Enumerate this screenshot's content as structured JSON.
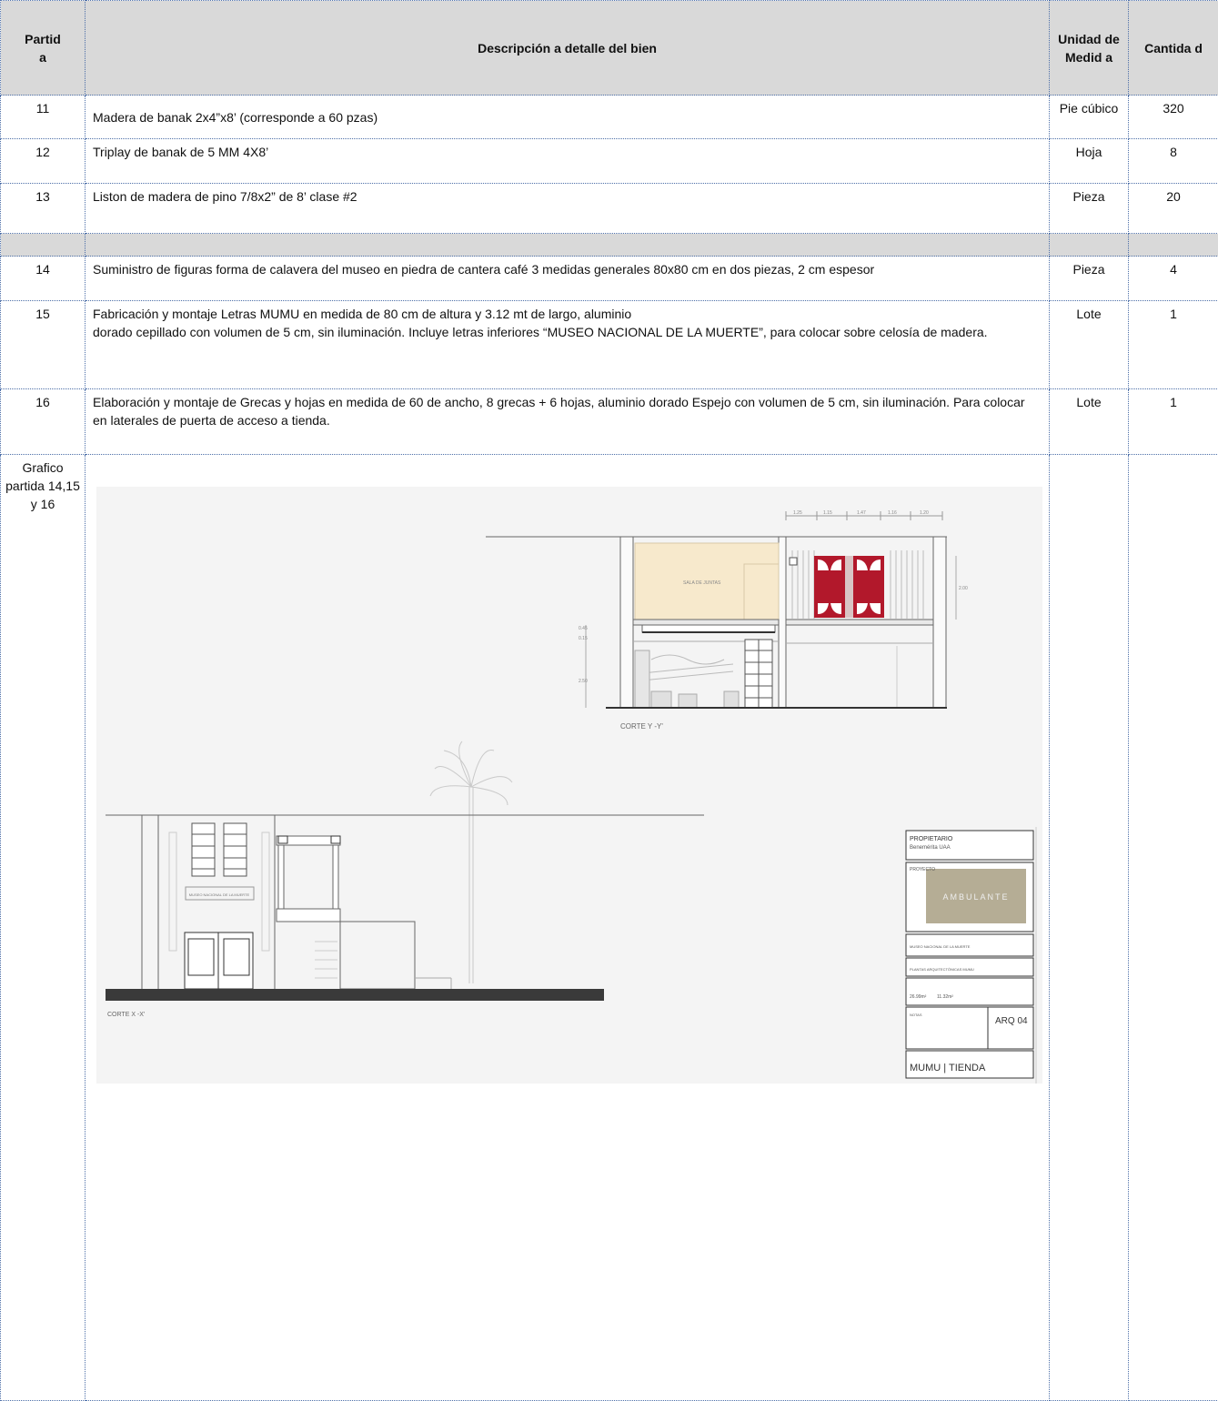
{
  "header": {
    "col_partida": "Partid\na",
    "col_descripcion": "Descripción a detalle del bien",
    "col_unidad": "Unidad de Medid a",
    "col_cantidad": "Cantida d"
  },
  "rows": [
    {
      "partida": "11",
      "descripcion": "Madera de banak 2x4”x8’ (corresponde a 60 pzas)",
      "unidad": "Pie cúbico",
      "cantidad": "320"
    },
    {
      "partida": "12",
      "descripcion": "Triplay de banak de 5 MM 4X8’",
      "unidad": "Hoja",
      "cantidad": "8"
    },
    {
      "partida": "13",
      "descripcion": "Liston de madera de pino 7/8x2” de 8’ clase #2",
      "unidad": "Pieza",
      "cantidad": "20"
    },
    {
      "partida": "14",
      "descripcion": "Suministro de figuras forma de calavera del museo en piedra de cantera café 3 medidas generales 80x80 cm en dos piezas, 2 cm espesor",
      "unidad": "Pieza",
      "cantidad": "4"
    },
    {
      "partida": "15",
      "descripcion_line1": "Fabricación y montaje Letras MUMU en medida de 80 cm de altura y 3.12 mt de largo, aluminio",
      "descripcion_line2": "dorado cepillado con volumen de 5 cm, sin iluminación. Incluye letras inferiores “MUSEO NACIONAL DE LA MUERTE”, para colocar sobre celosía de madera.",
      "unidad": "Lote",
      "cantidad": "1"
    },
    {
      "partida": "16",
      "descripcion": "Elaboración y montaje de Grecas y hojas en medida de 60 de ancho, 8 grecas + 6 hojas, aluminio dorado Espejo con volumen de 5 cm, sin iluminación. Para colocar en laterales de puerta de acceso a tienda.",
      "unidad": "Lote",
      "cantidad": "1"
    }
  ],
  "grafico": {
    "label": "Grafico partida 14,15 y 16",
    "corte_y": "CORTE Y -Y'",
    "corte_x": "CORTE X -X'",
    "sala": "SALA DE JUNTAS",
    "dims_top": [
      "1.25",
      "1.15",
      "1.47",
      "1.16",
      "1.20"
    ],
    "dim_right": "2.00",
    "dims_left": [
      "0.45",
      "0.15",
      "2.50"
    ],
    "propietario_label": "PROPIETARIO",
    "propietario_value": "Beneméritа UAA",
    "proyecto_label": "PROYECTO",
    "brand": "AMBULANTE",
    "ubicacion": "MUSEO NACIONAL DE LA MUERTE",
    "plano": "PLANTAS ARQUITECTÓNICAS MUMU",
    "areas": [
      "26.99m²",
      "11.32m²"
    ],
    "notas": "NOTAS",
    "sheet": "ARQ 04",
    "titulo": "MUMU | TIENDA",
    "sign_text": "MUSEO NACIONAL DE LA MUERTE",
    "colors": {
      "beige": "#f7e9cc",
      "red": "#b2182b",
      "ground": "#3a3a3a",
      "panel": "#b5ad95"
    }
  }
}
